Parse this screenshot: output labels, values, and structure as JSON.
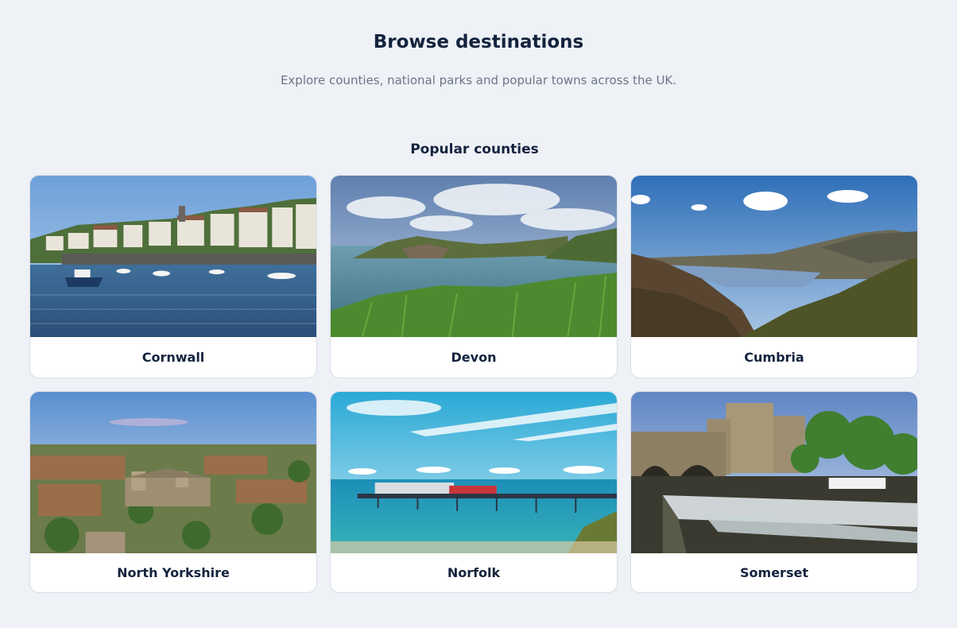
{
  "header": {
    "title": "Browse destinations",
    "subtitle": "Explore counties, national parks and popular towns across the UK."
  },
  "section": {
    "title": "Popular counties"
  },
  "counties": [
    {
      "name": "Cornwall",
      "image": "harbour-with-boats-photo"
    },
    {
      "name": "Devon",
      "image": "coastal-bay-photo"
    },
    {
      "name": "Cumbria",
      "image": "lake-valley-photo"
    },
    {
      "name": "North Yorkshire",
      "image": "aerial-town-abbey-photo"
    },
    {
      "name": "Norfolk",
      "image": "seaside-pier-photo"
    },
    {
      "name": "Somerset",
      "image": "bridge-weir-photo"
    }
  ]
}
